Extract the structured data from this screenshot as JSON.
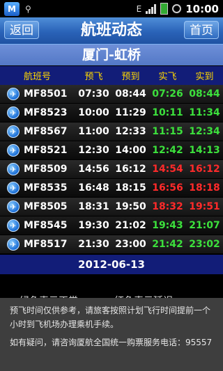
{
  "status_bar": {
    "app_icon": "M",
    "usb_icon": "usb-icon",
    "network": "E",
    "time": "10:00"
  },
  "header": {
    "back_label": "返回",
    "title": "航班动态",
    "home_label": "首页"
  },
  "route": "厦门-虹桥",
  "table": {
    "columns": [
      "航班号",
      "预飞",
      "预到",
      "实飞",
      "实到"
    ],
    "rows": [
      {
        "flight": "MF8501",
        "sched_dep": "07:30",
        "sched_arr": "08:44",
        "act_dep": "07:26",
        "act_arr": "08:44",
        "status": "ontime"
      },
      {
        "flight": "MF8523",
        "sched_dep": "10:00",
        "sched_arr": "11:29",
        "act_dep": "10:11",
        "act_arr": "11:34",
        "status": "ontime"
      },
      {
        "flight": "MF8567",
        "sched_dep": "11:00",
        "sched_arr": "12:33",
        "act_dep": "11:15",
        "act_arr": "12:34",
        "status": "ontime"
      },
      {
        "flight": "MF8521",
        "sched_dep": "12:30",
        "sched_arr": "14:00",
        "act_dep": "12:42",
        "act_arr": "14:13",
        "status": "ontime"
      },
      {
        "flight": "MF8509",
        "sched_dep": "14:56",
        "sched_arr": "16:12",
        "act_dep": "14:54",
        "act_arr": "16:12",
        "status": "delayed"
      },
      {
        "flight": "MF8535",
        "sched_dep": "16:48",
        "sched_arr": "18:15",
        "act_dep": "16:56",
        "act_arr": "18:18",
        "status": "delayed"
      },
      {
        "flight": "MF8505",
        "sched_dep": "18:31",
        "sched_arr": "19:50",
        "act_dep": "18:32",
        "act_arr": "19:51",
        "status": "delayed"
      },
      {
        "flight": "MF8545",
        "sched_dep": "19:30",
        "sched_arr": "21:02",
        "act_dep": "19:43",
        "act_arr": "21:07",
        "status": "ontime"
      },
      {
        "flight": "MF8517",
        "sched_dep": "21:30",
        "sched_arr": "23:00",
        "act_dep": "21:42",
        "act_arr": "23:02",
        "status": "ontime"
      }
    ]
  },
  "date": "2012-06-13",
  "legend": {
    "ontime_label": "绿色表示正常",
    "delayed_label": "红色表示延误",
    "ontime_color": "#2bd72b",
    "delayed_color": "#e01818"
  },
  "notice": {
    "line1": "预飞时间仅供参考，请旅客按照计划飞行时间提前一个小时到飞机场办理乘机手续。",
    "line2": "如有疑问，请咨询厦航全国统一购票服务电话：95557"
  }
}
